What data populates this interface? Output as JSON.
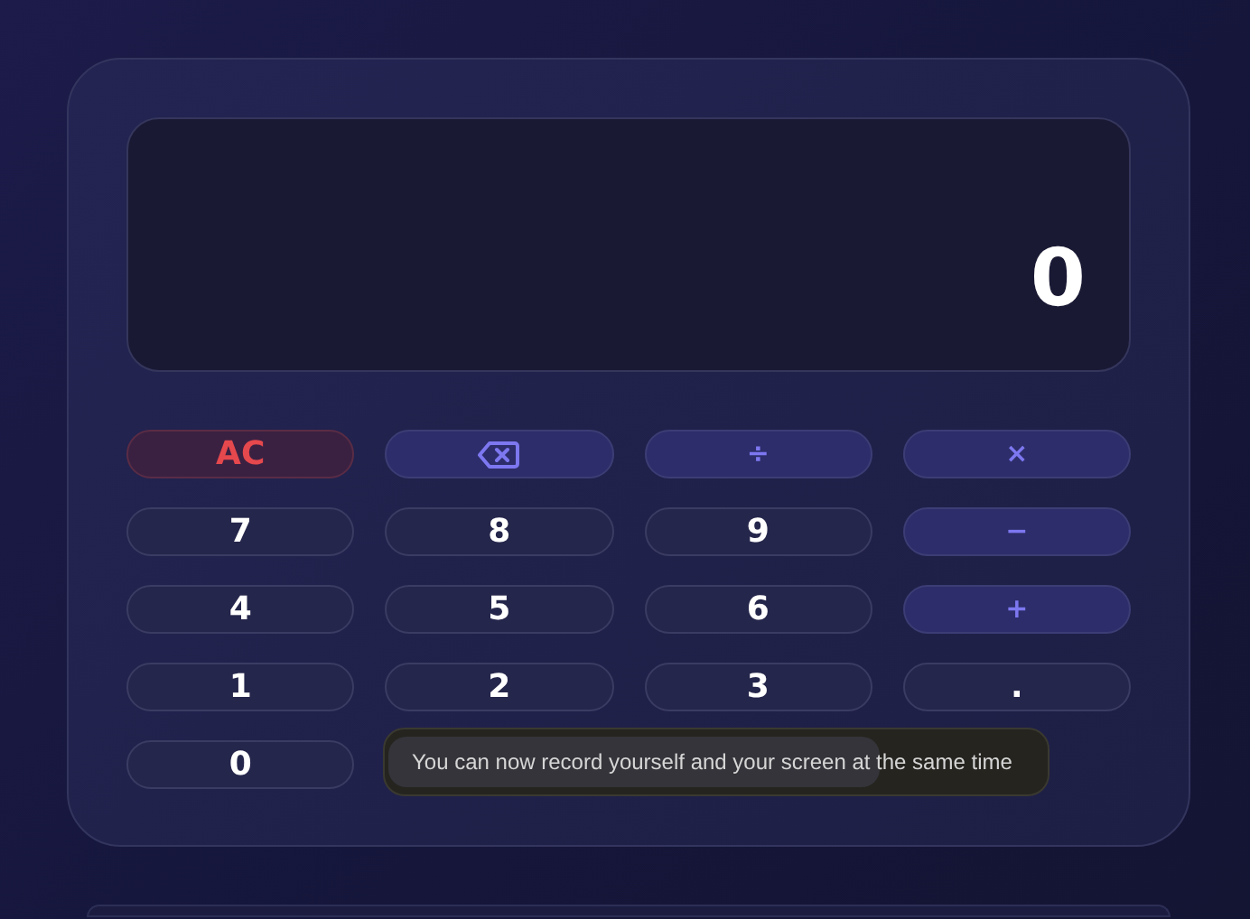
{
  "display": {
    "value": "0"
  },
  "keys": [
    {
      "label": "AC",
      "kind": "clear"
    },
    {
      "kind": "backspace"
    },
    {
      "label": "÷",
      "kind": "op"
    },
    {
      "label": "×",
      "kind": "op"
    },
    {
      "label": "7",
      "kind": "digit"
    },
    {
      "label": "8",
      "kind": "digit"
    },
    {
      "label": "9",
      "kind": "digit"
    },
    {
      "label": "−",
      "kind": "op"
    },
    {
      "label": "4",
      "kind": "digit"
    },
    {
      "label": "5",
      "kind": "digit"
    },
    {
      "label": "6",
      "kind": "digit"
    },
    {
      "label": "+",
      "kind": "op"
    },
    {
      "label": "1",
      "kind": "digit"
    },
    {
      "label": "2",
      "kind": "digit"
    },
    {
      "label": "3",
      "kind": "digit"
    },
    {
      "label": ".",
      "kind": "digit"
    },
    {
      "label": "0",
      "kind": "digit"
    }
  ],
  "toast": {
    "text": "You can now record yourself and your screen at the same time",
    "level": 0.74
  }
}
